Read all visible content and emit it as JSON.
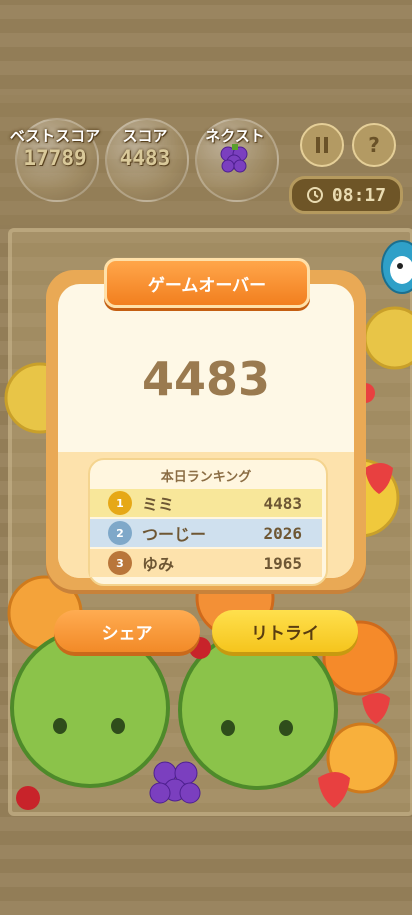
{
  "hud": {
    "best_label": "ベストスコア",
    "best_value": "17789",
    "score_label": "スコア",
    "score_value": "4483",
    "next_label": "ネクスト",
    "next_fruit": "grape",
    "pause_icon": "pause-icon",
    "help_label": "?",
    "timer_value": "08:17",
    "timer_icon": "clock-icon"
  },
  "modal": {
    "title": "ゲームオーバー",
    "final_score": "4483",
    "ranking_title": "本日ランキング",
    "ranking": [
      {
        "rank": "1",
        "name": "ミミ",
        "score": "4483",
        "color": "#f8e79a"
      },
      {
        "rank": "2",
        "name": "つーじー",
        "score": "2026",
        "color": "#cfe0ee"
      },
      {
        "rank": "3",
        "name": "ゆみ",
        "score": "1965",
        "color": "#fde2ac"
      }
    ]
  },
  "actions": {
    "share_label": "シェア",
    "retry_label": "リトライ"
  },
  "colors": {
    "accent_orange": "#f28a28",
    "accent_yellow": "#f5c51d",
    "modal_frame": "#e9a955"
  }
}
